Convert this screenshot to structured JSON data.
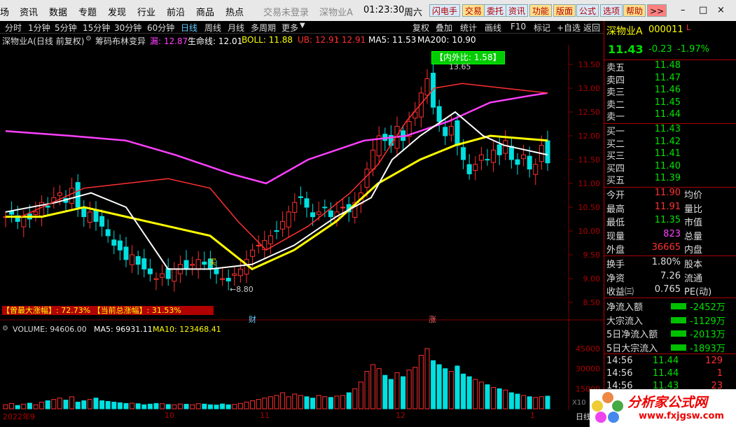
{
  "menu": {
    "left_items": [
      "场",
      "资讯",
      "数据",
      "专题",
      "发现",
      "行业",
      "前沿",
      "商品",
      "热点"
    ],
    "login_status": "交易未登录",
    "stock_name": "深物业A",
    "time": "01:23:30",
    "weekday": "周六",
    "right_buttons": [
      "闪电手",
      "交易",
      "委托",
      "资讯",
      "功能",
      "版面",
      "公式",
      "选项",
      "帮助"
    ],
    "more_label": ">>",
    "window_controls": {
      "minimize": "–",
      "restore": "□",
      "close": "×"
    }
  },
  "period_bar": {
    "items": [
      "分时",
      "1分钟",
      "5分钟",
      "15分钟",
      "30分钟",
      "60分钟",
      "日线",
      "周线",
      "月线",
      "多周期",
      "更多"
    ],
    "active": "日线",
    "tools": [
      "复权",
      "叠加",
      "统计",
      "画线",
      "F10",
      "标记",
      "+自选",
      "返回"
    ]
  },
  "info_line": {
    "title": "深物业A(日线 前复权)",
    "indicator": "筹码布林变异",
    "items": [
      {
        "label": "漏: 12.87",
        "color": "#ff40ff"
      },
      {
        "label": "生命线: 12.01",
        "color": "#ffffff"
      },
      {
        "label": "BOLL: 11.88",
        "color": "#ffff00"
      },
      {
        "label": "UB: 12.91",
        "color": "#ff3030"
      },
      {
        "label": ": 12.91",
        "color": "#ff3030"
      },
      {
        "label": "MA5: 11.53",
        "color": "#ffffff"
      },
      {
        "label": "MA200: 10.90",
        "color": "#ffffff"
      }
    ]
  },
  "chart_annotations": {
    "inout_ratio": "【内外比: 1.58】",
    "high_price_label": "13.65",
    "low_price_label": "←8.80",
    "buy_label": "买",
    "stat_line_1": "【曾最大涨幅】: 72.73%",
    "stat_line_2": "【当前总涨幅】: 31.53%",
    "marker_cai": "财",
    "marker_zhang": "涨"
  },
  "price_axis": [
    "13.50",
    "13.00",
    "12.50",
    "12.00",
    "11.50",
    "11.00",
    "10.50",
    "10.00",
    "9.50",
    "9.00",
    "8.50"
  ],
  "volume_panel": {
    "label": "VOLUME: 94606.00",
    "ma5": "MA5: 96931.11",
    "ma10": "MA10: 123468.41",
    "axis": [
      "45000",
      "30000",
      "15000"
    ],
    "unit": "X10"
  },
  "date_axis": [
    "2022年9",
    "10",
    "11",
    "12",
    "1"
  ],
  "date_axis_right": "日线",
  "quote": {
    "name": "深物业A",
    "code": "000011",
    "flag": "L",
    "price": "11.43",
    "change": "-0.23",
    "pct": "-1.97%",
    "asks": [
      {
        "label": "卖五",
        "price": "11.48"
      },
      {
        "label": "卖四",
        "price": "11.47"
      },
      {
        "label": "卖三",
        "price": "11.46"
      },
      {
        "label": "卖二",
        "price": "11.45"
      },
      {
        "label": "卖一",
        "price": "11.44"
      }
    ],
    "bids": [
      {
        "label": "买一",
        "price": "11.43"
      },
      {
        "label": "买二",
        "price": "11.42"
      },
      {
        "label": "买三",
        "price": "11.41"
      },
      {
        "label": "买四",
        "price": "11.40"
      },
      {
        "label": "买五",
        "price": "11.39"
      }
    ],
    "stats": [
      {
        "label": "今开",
        "value": "11.90",
        "label2": "均价"
      },
      {
        "label": "最高",
        "value": "11.91",
        "label2": "量比"
      },
      {
        "label": "最低",
        "value": "11.35",
        "label2": "市值"
      },
      {
        "label": "现量",
        "value": "823",
        "label2": "总量"
      },
      {
        "label": "外盘",
        "value": "36665",
        "label2": "内盘"
      }
    ],
    "stats2": [
      {
        "label": "换手",
        "value": "1.80%",
        "label2": "股本"
      },
      {
        "label": "净资",
        "value": "7.26",
        "label2": "流通"
      },
      {
        "label": "收益㈢",
        "value": "0.765",
        "label2": "PE(动)"
      }
    ],
    "flows": [
      {
        "label": "净流入额",
        "value": "-2452万"
      },
      {
        "label": "大宗流入",
        "value": "-1129万"
      },
      {
        "label": "5日净流入额",
        "value": "-2013万"
      },
      {
        "label": "5日大宗流入",
        "value": "-1893万"
      }
    ],
    "ticks": [
      {
        "time": "14:56",
        "price": "11.44",
        "vol": "129"
      },
      {
        "time": "14:56",
        "price": "11.44",
        "vol": "1"
      },
      {
        "time": "14:56",
        "price": "11.43",
        "vol": "23"
      }
    ]
  },
  "watermark": {
    "text": "分析家公式网",
    "url": "www.fxjgsw.com"
  },
  "colors": {
    "up": "#ff3030",
    "down": "#00e0e0",
    "boll_mid": "#ffff00",
    "upper": "#ff40ff"
  }
}
